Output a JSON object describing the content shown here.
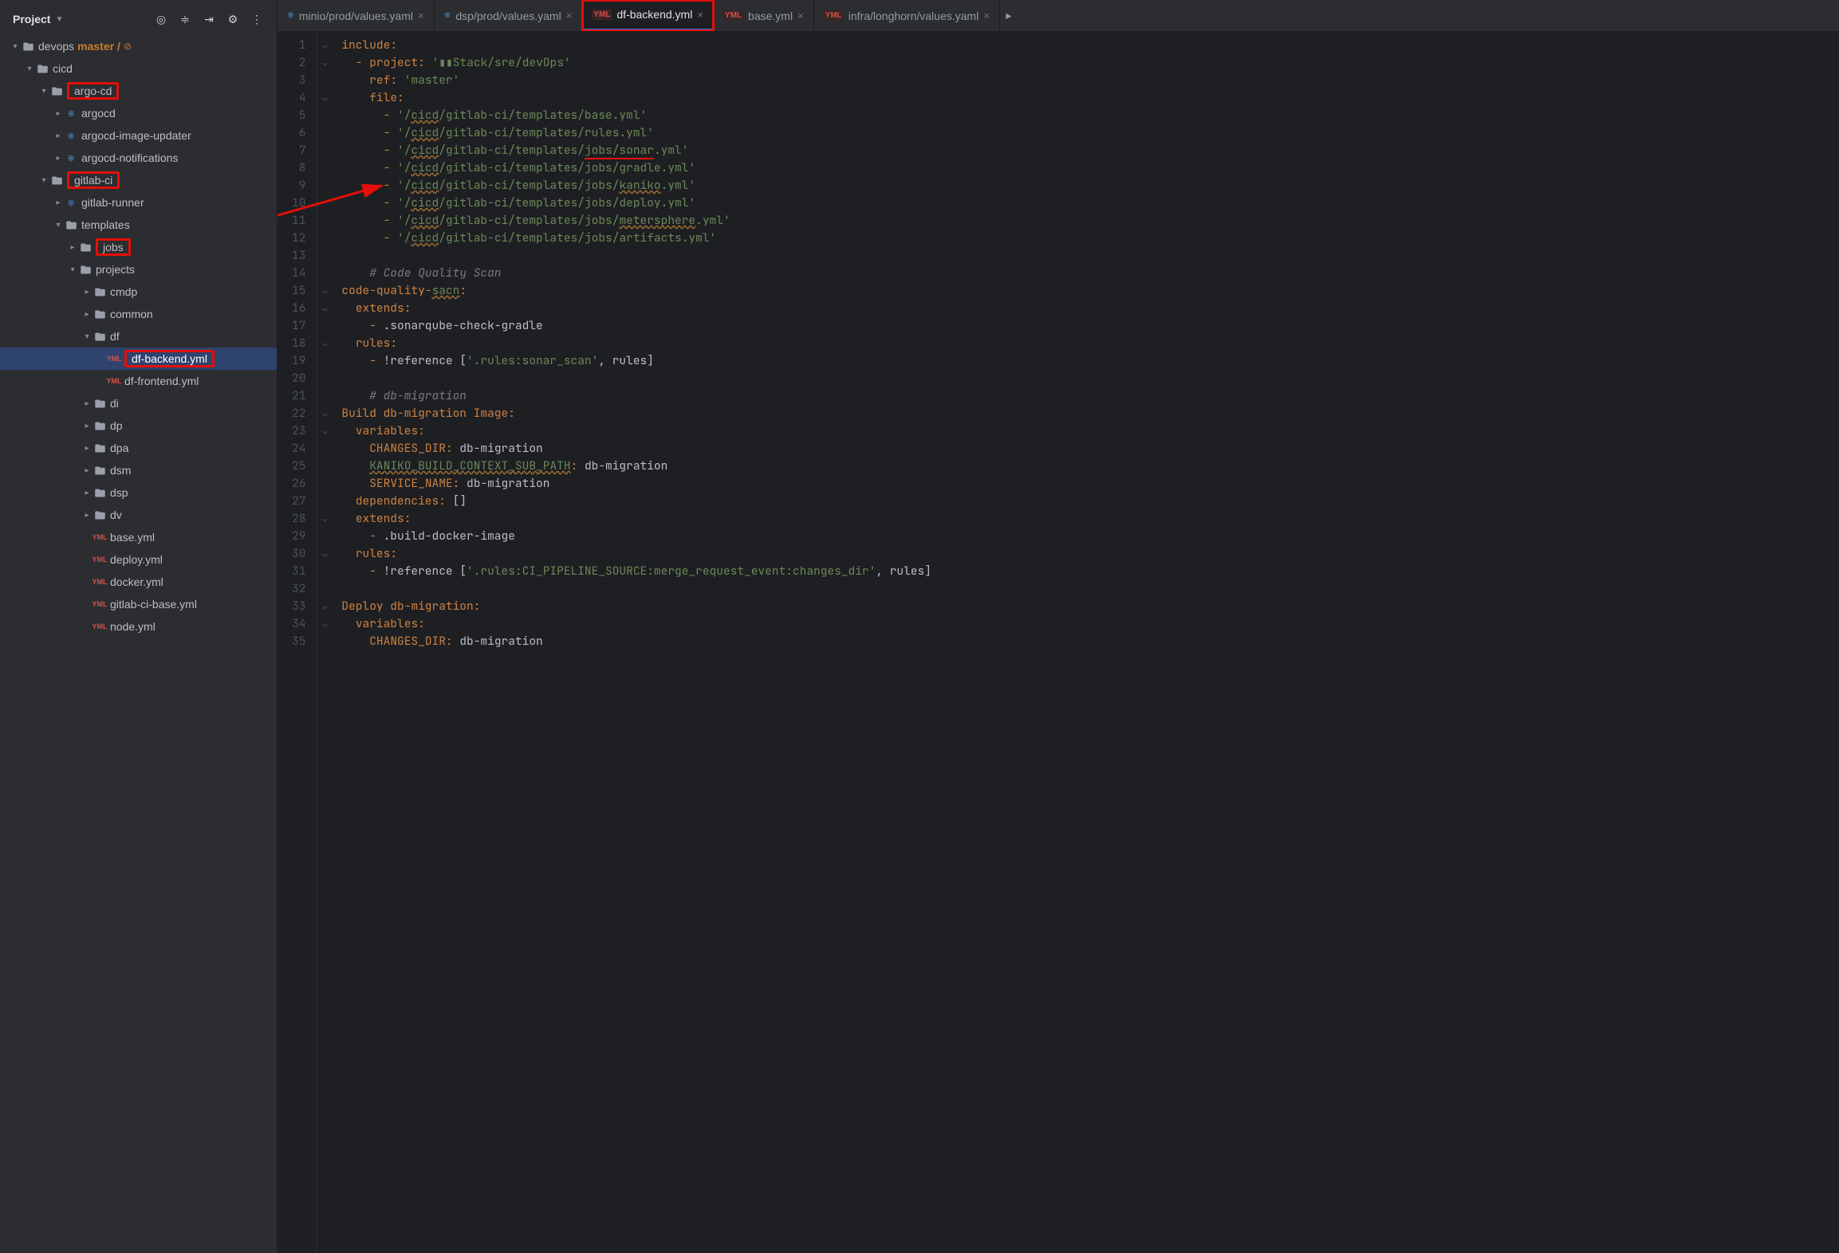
{
  "header": {
    "project_label": "Project"
  },
  "sidebar": {
    "root": "devops",
    "branch": "master /",
    "items": [
      {
        "depth": 0,
        "chev": "v",
        "type": "root",
        "label": "devops"
      },
      {
        "depth": 1,
        "chev": "v",
        "type": "folder",
        "label": "cicd"
      },
      {
        "depth": 2,
        "chev": "v",
        "type": "folder",
        "label": "argo-cd",
        "hl": true
      },
      {
        "depth": 3,
        "chev": ">",
        "type": "kub",
        "label": "argocd"
      },
      {
        "depth": 3,
        "chev": ">",
        "type": "kub",
        "label": "argocd-image-updater"
      },
      {
        "depth": 3,
        "chev": ">",
        "type": "kub",
        "label": "argocd-notifications"
      },
      {
        "depth": 2,
        "chev": "v",
        "type": "folder",
        "label": "gitlab-ci",
        "hl": true
      },
      {
        "depth": 3,
        "chev": ">",
        "type": "kub",
        "label": "gitlab-runner"
      },
      {
        "depth": 3,
        "chev": "v",
        "type": "folder",
        "label": "templates"
      },
      {
        "depth": 4,
        "chev": ">",
        "type": "folder",
        "label": "jobs",
        "hl": true,
        "arrow_src": true
      },
      {
        "depth": 4,
        "chev": "v",
        "type": "folder",
        "label": "projects"
      },
      {
        "depth": 5,
        "chev": ">",
        "type": "folder",
        "label": "cmdp"
      },
      {
        "depth": 5,
        "chev": ">",
        "type": "folder",
        "label": "common"
      },
      {
        "depth": 5,
        "chev": "v",
        "type": "folder",
        "label": "df"
      },
      {
        "depth": 6,
        "chev": "",
        "type": "yml",
        "label": "df-backend.yml",
        "hl": true,
        "sel": true
      },
      {
        "depth": 6,
        "chev": "",
        "type": "yml",
        "label": "df-frontend.yml"
      },
      {
        "depth": 5,
        "chev": ">",
        "type": "folder",
        "label": "di"
      },
      {
        "depth": 5,
        "chev": ">",
        "type": "folder",
        "label": "dp"
      },
      {
        "depth": 5,
        "chev": ">",
        "type": "folder",
        "label": "dpa"
      },
      {
        "depth": 5,
        "chev": ">",
        "type": "folder",
        "label": "dsm"
      },
      {
        "depth": 5,
        "chev": ">",
        "type": "folder",
        "label": "dsp"
      },
      {
        "depth": 5,
        "chev": ">",
        "type": "folder",
        "label": "dv"
      },
      {
        "depth": 5,
        "chev": "",
        "type": "yml",
        "label": "base.yml"
      },
      {
        "depth": 5,
        "chev": "",
        "type": "yml",
        "label": "deploy.yml"
      },
      {
        "depth": 5,
        "chev": "",
        "type": "yml",
        "label": "docker.yml"
      },
      {
        "depth": 5,
        "chev": "",
        "type": "yml",
        "label": "gitlab-ci-base.yml"
      },
      {
        "depth": 5,
        "chev": "",
        "type": "yml",
        "label": "node.yml"
      }
    ]
  },
  "tabs": [
    {
      "icon": "kub",
      "label": "minio/prod/values.yaml",
      "active": false
    },
    {
      "icon": "kub",
      "label": "dsp/prod/values.yaml",
      "active": false
    },
    {
      "icon": "yml",
      "label": "df-backend.yml",
      "active": true,
      "hl": true
    },
    {
      "icon": "yml",
      "label": "base.yml",
      "active": false
    },
    {
      "icon": "yml",
      "label": "infra/longhorn/values.yaml",
      "active": false
    }
  ],
  "code": {
    "lines": [
      {
        "n": 1,
        "seg": [
          [
            "key",
            "include"
          ],
          [
            "punc",
            ":"
          ]
        ]
      },
      {
        "n": 2,
        "seg": [
          [
            "dash",
            "  - "
          ],
          [
            "key",
            "project"
          ],
          [
            "punc",
            ": "
          ],
          [
            "str",
            "'▮▮Stack/sre/devOps'"
          ]
        ]
      },
      {
        "n": 3,
        "seg": [
          [
            "plain",
            "    "
          ],
          [
            "key",
            "ref"
          ],
          [
            "punc",
            ": "
          ],
          [
            "str",
            "'master'"
          ]
        ]
      },
      {
        "n": 4,
        "seg": [
          [
            "plain",
            "    "
          ],
          [
            "key",
            "file"
          ],
          [
            "punc",
            ":"
          ]
        ]
      },
      {
        "n": 5,
        "seg": [
          [
            "dash",
            "      - "
          ],
          [
            "str",
            "'/"
          ],
          [
            "warn",
            "cicd"
          ],
          [
            "str",
            "/gitlab-ci/templates/base.yml'"
          ]
        ]
      },
      {
        "n": 6,
        "seg": [
          [
            "dash",
            "      - "
          ],
          [
            "str",
            "'/"
          ],
          [
            "warn",
            "cicd"
          ],
          [
            "str",
            "/gitlab-ci/templates/rules.yml'"
          ]
        ]
      },
      {
        "n": 7,
        "seg": [
          [
            "dash",
            "      - "
          ],
          [
            "str",
            "'/"
          ],
          [
            "warn",
            "cicd"
          ],
          [
            "str",
            "/gitlab-ci/templates/"
          ],
          [
            "ured",
            "jobs/sonar"
          ],
          [
            "str",
            ".yml'"
          ]
        ]
      },
      {
        "n": 8,
        "seg": [
          [
            "dash",
            "      - "
          ],
          [
            "str",
            "'/"
          ],
          [
            "warn",
            "cicd"
          ],
          [
            "str",
            "/gitlab-ci/templates/jobs/gradle.yml'"
          ]
        ]
      },
      {
        "n": 9,
        "seg": [
          [
            "dash",
            "      - "
          ],
          [
            "str",
            "'/"
          ],
          [
            "warn",
            "cicd"
          ],
          [
            "str",
            "/gitlab-ci/templates/jobs/"
          ],
          [
            "warn",
            "kaniko"
          ],
          [
            "str",
            ".yml'"
          ]
        ],
        "arrow_to": true
      },
      {
        "n": 10,
        "seg": [
          [
            "dash",
            "      - "
          ],
          [
            "str",
            "'/"
          ],
          [
            "warn",
            "cicd"
          ],
          [
            "str",
            "/gitlab-ci/templates/jobs/deploy.yml'"
          ]
        ]
      },
      {
        "n": 11,
        "seg": [
          [
            "dash",
            "      - "
          ],
          [
            "str",
            "'/"
          ],
          [
            "warn",
            "cicd"
          ],
          [
            "str",
            "/gitlab-ci/templates/jobs/"
          ],
          [
            "warn",
            "metersphere"
          ],
          [
            "str",
            ".yml'"
          ]
        ]
      },
      {
        "n": 12,
        "seg": [
          [
            "dash",
            "      - "
          ],
          [
            "str",
            "'/"
          ],
          [
            "warn",
            "cicd"
          ],
          [
            "str",
            "/gitlab-ci/templates/jobs/artifacts.yml'"
          ]
        ]
      },
      {
        "n": 13,
        "seg": []
      },
      {
        "n": 14,
        "seg": [
          [
            "comm",
            "    # Code Quality Scan"
          ]
        ]
      },
      {
        "n": 15,
        "seg": [
          [
            "key",
            "code-quality-"
          ],
          [
            "warn",
            "sacn"
          ],
          [
            "punc",
            ":"
          ]
        ]
      },
      {
        "n": 16,
        "seg": [
          [
            "plain",
            "  "
          ],
          [
            "key",
            "extends"
          ],
          [
            "punc",
            ":"
          ]
        ]
      },
      {
        "n": 17,
        "seg": [
          [
            "dash",
            "    - "
          ],
          [
            "plain",
            ".sonarqube-check-gradle"
          ]
        ]
      },
      {
        "n": 18,
        "seg": [
          [
            "plain",
            "  "
          ],
          [
            "key",
            "rules"
          ],
          [
            "punc",
            ":"
          ]
        ]
      },
      {
        "n": 19,
        "seg": [
          [
            "dash",
            "    - "
          ],
          [
            "plain",
            "!reference "
          ],
          [
            "bracket",
            "["
          ],
          [
            "str",
            "'.rules:sonar_scan'"
          ],
          [
            "plain",
            ", rules"
          ],
          [
            "bracket",
            "]"
          ]
        ]
      },
      {
        "n": 20,
        "seg": []
      },
      {
        "n": 21,
        "seg": [
          [
            "comm",
            "    # db-migration"
          ]
        ]
      },
      {
        "n": 22,
        "seg": [
          [
            "key",
            "Build db-migration Image"
          ],
          [
            "punc",
            ":"
          ]
        ]
      },
      {
        "n": 23,
        "seg": [
          [
            "plain",
            "  "
          ],
          [
            "key",
            "variables"
          ],
          [
            "punc",
            ":"
          ]
        ]
      },
      {
        "n": 24,
        "seg": [
          [
            "plain",
            "    "
          ],
          [
            "key",
            "CHANGES_DIR"
          ],
          [
            "punc",
            ": "
          ],
          [
            "plain",
            "db-migration"
          ]
        ]
      },
      {
        "n": 25,
        "seg": [
          [
            "plain",
            "    "
          ],
          [
            "warn",
            "KANIKO_BUILD_CONTEXT_SUB_PATH"
          ],
          [
            "punc",
            ": "
          ],
          [
            "plain",
            "db-migration"
          ]
        ]
      },
      {
        "n": 26,
        "seg": [
          [
            "plain",
            "    "
          ],
          [
            "key",
            "SERVICE_NAME"
          ],
          [
            "punc",
            ": "
          ],
          [
            "plain",
            "db-migration"
          ]
        ]
      },
      {
        "n": 27,
        "seg": [
          [
            "plain",
            "  "
          ],
          [
            "key",
            "dependencies"
          ],
          [
            "punc",
            ": "
          ],
          [
            "bracket",
            "[]"
          ]
        ]
      },
      {
        "n": 28,
        "seg": [
          [
            "plain",
            "  "
          ],
          [
            "key",
            "extends"
          ],
          [
            "punc",
            ":"
          ]
        ]
      },
      {
        "n": 29,
        "seg": [
          [
            "dash",
            "    - "
          ],
          [
            "plain",
            ".build-docker-image"
          ]
        ]
      },
      {
        "n": 30,
        "seg": [
          [
            "plain",
            "  "
          ],
          [
            "key",
            "rules"
          ],
          [
            "punc",
            ":"
          ]
        ]
      },
      {
        "n": 31,
        "seg": [
          [
            "dash",
            "    - "
          ],
          [
            "plain",
            "!reference "
          ],
          [
            "bracket",
            "["
          ],
          [
            "str",
            "'.rules:CI_PIPELINE_SOURCE:merge_request_event:changes_dir'"
          ],
          [
            "plain",
            ", rules"
          ],
          [
            "bracket",
            "]"
          ]
        ]
      },
      {
        "n": 32,
        "seg": []
      },
      {
        "n": 33,
        "seg": [
          [
            "key",
            "Deploy db-migration"
          ],
          [
            "punc",
            ":"
          ]
        ]
      },
      {
        "n": 34,
        "seg": [
          [
            "plain",
            "  "
          ],
          [
            "key",
            "variables"
          ],
          [
            "punc",
            ":"
          ]
        ]
      },
      {
        "n": 35,
        "seg": [
          [
            "plain",
            "    "
          ],
          [
            "key",
            "CHANGES_DIR"
          ],
          [
            "punc",
            ": "
          ],
          [
            "plain",
            "db-migration"
          ]
        ]
      }
    ]
  }
}
